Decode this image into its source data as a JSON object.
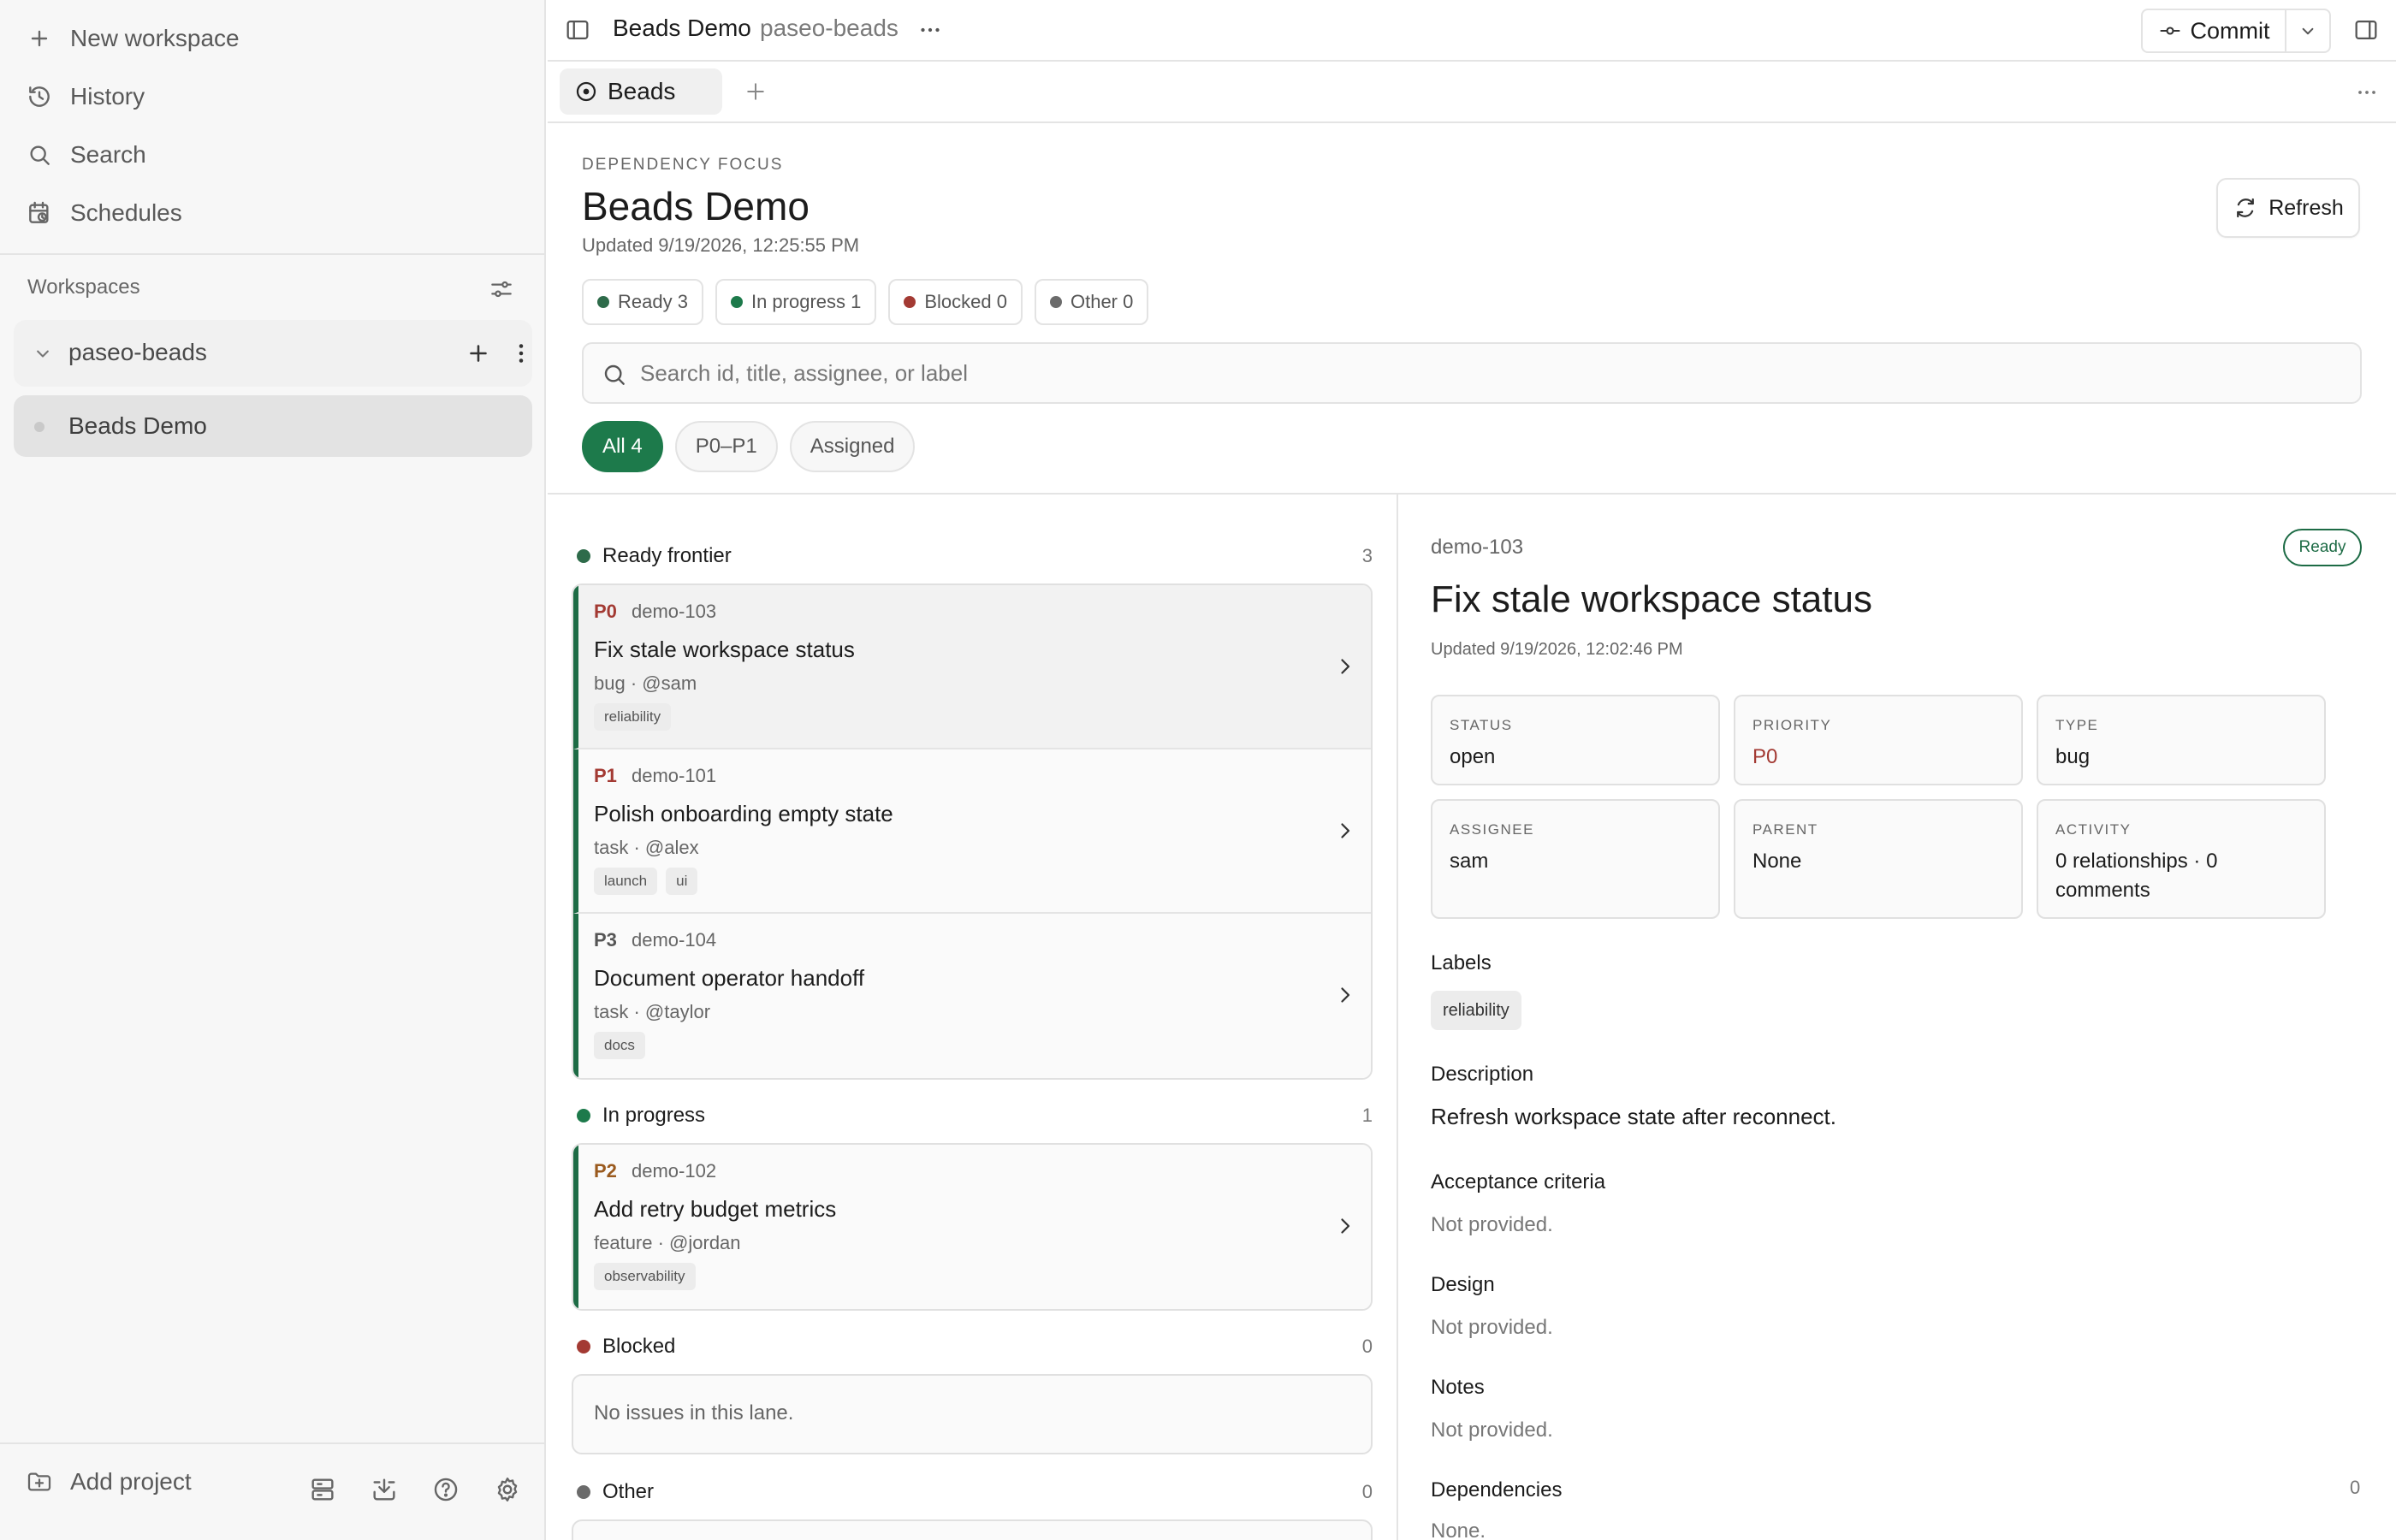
{
  "sidebar": {
    "nav": [
      {
        "label": "New workspace",
        "icon": "plus-icon"
      },
      {
        "label": "History",
        "icon": "history-icon"
      },
      {
        "label": "Search",
        "icon": "search-icon"
      },
      {
        "label": "Schedules",
        "icon": "calendar-clock-icon"
      }
    ],
    "workspaces_label": "Workspaces",
    "group_name": "paseo-beads",
    "workspace_item": "Beads Demo",
    "add_project": "Add project"
  },
  "topbar": {
    "title": "Beads Demo",
    "subtitle": "paseo-beads",
    "commit_label": "Commit"
  },
  "tabs": {
    "active_label": "Beads"
  },
  "header": {
    "eyebrow": "DEPENDENCY FOCUS",
    "title": "Beads Demo",
    "updated": "Updated 9/19/2026, 12:25:55 PM",
    "refresh_label": "Refresh",
    "chips": [
      {
        "label": "Ready 3",
        "color": "#2e6b4a"
      },
      {
        "label": "In progress 1",
        "color": "#1d7a4b"
      },
      {
        "label": "Blocked 0",
        "color": "#a33a33"
      },
      {
        "label": "Other 0",
        "color": "#6b6b6b"
      }
    ],
    "search_placeholder": "Search id, title, assignee, or label",
    "filters": [
      "All 4",
      "P0–P1",
      "Assigned"
    ]
  },
  "lanes": {
    "ready": {
      "label": "Ready frontier",
      "count": "3",
      "color": "#2e6b4a",
      "cards": [
        {
          "priority": "P0",
          "priority_color": "#a33a33",
          "id": "demo-103",
          "title": "Fix stale workspace status",
          "meta": "bug · @sam",
          "tags": [
            "reliability"
          ]
        },
        {
          "priority": "P1",
          "priority_color": "#a33a33",
          "id": "demo-101",
          "title": "Polish onboarding empty state",
          "meta": "task · @alex",
          "tags": [
            "launch",
            "ui"
          ]
        },
        {
          "priority": "P3",
          "priority_color": "#555555",
          "id": "demo-104",
          "title": "Document operator handoff",
          "meta": "task · @taylor",
          "tags": [
            "docs"
          ]
        }
      ]
    },
    "in_progress": {
      "label": "In progress",
      "count": "1",
      "color": "#1d7a4b",
      "cards": [
        {
          "priority": "P2",
          "priority_color": "#9a5a1e",
          "id": "demo-102",
          "title": "Add retry budget metrics",
          "meta": "feature · @jordan",
          "tags": [
            "observability"
          ]
        }
      ]
    },
    "blocked": {
      "label": "Blocked",
      "count": "0",
      "color": "#a33a33",
      "empty_text": "No issues in this lane."
    },
    "other": {
      "label": "Other",
      "count": "0",
      "color": "#6b6b6b"
    }
  },
  "detail": {
    "id": "demo-103",
    "status_pill": "Ready",
    "title": "Fix stale workspace status",
    "updated": "Updated 9/19/2026, 12:02:46 PM",
    "fields": {
      "status": {
        "label": "STATUS",
        "value": "open"
      },
      "priority": {
        "label": "PRIORITY",
        "value": "P0"
      },
      "type": {
        "label": "TYPE",
        "value": "bug"
      },
      "assignee": {
        "label": "ASSIGNEE",
        "value": "sam"
      },
      "parent": {
        "label": "PARENT",
        "value": "None"
      },
      "activity": {
        "label": "ACTIVITY",
        "value": "0 relationships · 0 comments"
      }
    },
    "labels_heading": "Labels",
    "labels": [
      "reliability"
    ],
    "description_heading": "Description",
    "description": "Refresh workspace state after reconnect.",
    "acceptance_heading": "Acceptance criteria",
    "acceptance": "Not provided.",
    "design_heading": "Design",
    "design": "Not provided.",
    "notes_heading": "Notes",
    "notes": "Not provided.",
    "dependencies_heading": "Dependencies",
    "dependencies_count": "0",
    "dependencies": "None."
  }
}
